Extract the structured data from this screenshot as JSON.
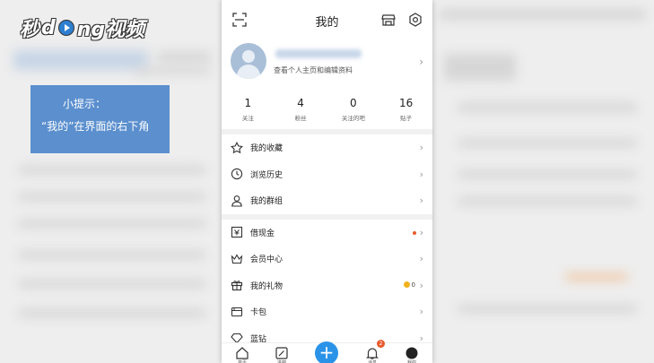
{
  "watermark": {
    "part1": "秒",
    "part2": "d",
    "part3": "ng视频"
  },
  "tip": {
    "line1": "小提示：",
    "line2": "“我的”在界面的右下角"
  },
  "header": {
    "title": "我的"
  },
  "profile": {
    "subtitle": "查看个人主页和编辑资料"
  },
  "stats": [
    {
      "value": "1",
      "label": "关注"
    },
    {
      "value": "4",
      "label": "粉丝"
    },
    {
      "value": "0",
      "label": "关注的吧"
    },
    {
      "value": "16",
      "label": "贴子"
    }
  ],
  "menu": {
    "favorites": "我的收藏",
    "history": "浏览历史",
    "groups": "我的群组",
    "loan": "借现金",
    "member": "会员中心",
    "gifts": "我的礼物",
    "gifts_count": "0",
    "wallet": "卡包",
    "diamond": "蓝钻"
  },
  "tabbar": {
    "home": "首页",
    "feed": "进吧",
    "post": "+",
    "messages": "消息",
    "messages_badge": "2",
    "mine": "我的"
  },
  "colors": {
    "accent": "#2a93e8",
    "tip_bg": "#5b8fce",
    "badge": "#e85a2d"
  }
}
